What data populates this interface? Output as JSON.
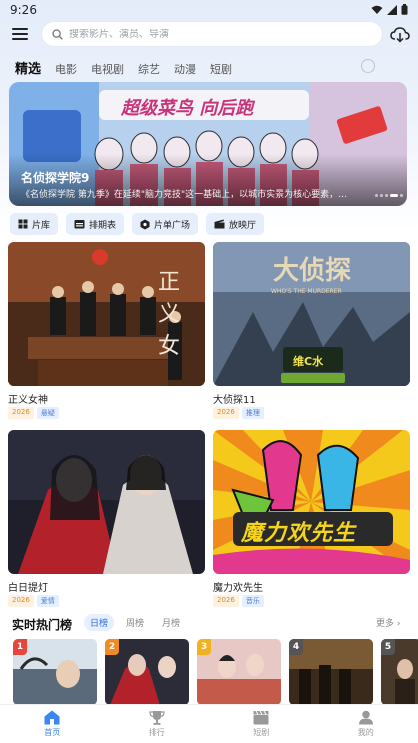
{
  "status": {
    "time": "9:26"
  },
  "search": {
    "placeholder": "搜索影片、演员、导演"
  },
  "tabs": [
    {
      "label": "精选"
    },
    {
      "label": "电影"
    },
    {
      "label": "电视剧"
    },
    {
      "label": "综艺"
    },
    {
      "label": "动漫"
    },
    {
      "label": "短剧"
    }
  ],
  "banner": {
    "title": "名侦探学院9",
    "description": "《名侦探学院 第九季》在延续\"脑力竞技\"这一基础上，以城市实景为核心要素，开创…",
    "logo_text": "超级菜鸟 向后跑"
  },
  "quick": [
    {
      "label": "片库",
      "icon": "film-library-icon"
    },
    {
      "label": "排期表",
      "icon": "schedule-icon"
    },
    {
      "label": "片单广场",
      "icon": "playlist-icon"
    },
    {
      "label": "放映厅",
      "icon": "cinema-icon"
    }
  ],
  "cards": [
    {
      "title": "正义女神",
      "year": "2026",
      "genre": "悬疑",
      "poster_text": "正义女"
    },
    {
      "title": "大侦探11",
      "year": "2026",
      "genre": "推理",
      "poster_text": "大侦探",
      "poster_sub": "WHO'S THE MURDERER",
      "poster_sponsor": "维C水"
    },
    {
      "title": "白日提灯",
      "year": "2026",
      "genre": "爱情"
    },
    {
      "title": "魔力欢先生",
      "year": "2026",
      "genre": "音乐",
      "poster_text": "魔力欢先生"
    }
  ],
  "hot": {
    "title": "实时热门榜",
    "tabs": [
      "日榜",
      "周榜",
      "月榜"
    ],
    "more": "更多",
    "ranks": [
      "1",
      "2",
      "3",
      "4",
      "5"
    ]
  },
  "nav": [
    {
      "label": "首页",
      "icon": "home-icon"
    },
    {
      "label": "排行",
      "icon": "trophy-icon"
    },
    {
      "label": "短剧",
      "icon": "clapperboard-icon"
    },
    {
      "label": "我的",
      "icon": "user-icon"
    }
  ],
  "colors": {
    "accent": "#3d86f0",
    "year_tag": "#e08a2a",
    "genre_tag": "#4a7fd6",
    "rank1": "#e8453c",
    "rank2": "#f08a24",
    "rank3": "#f2b21f",
    "rank_other": "#555555"
  }
}
